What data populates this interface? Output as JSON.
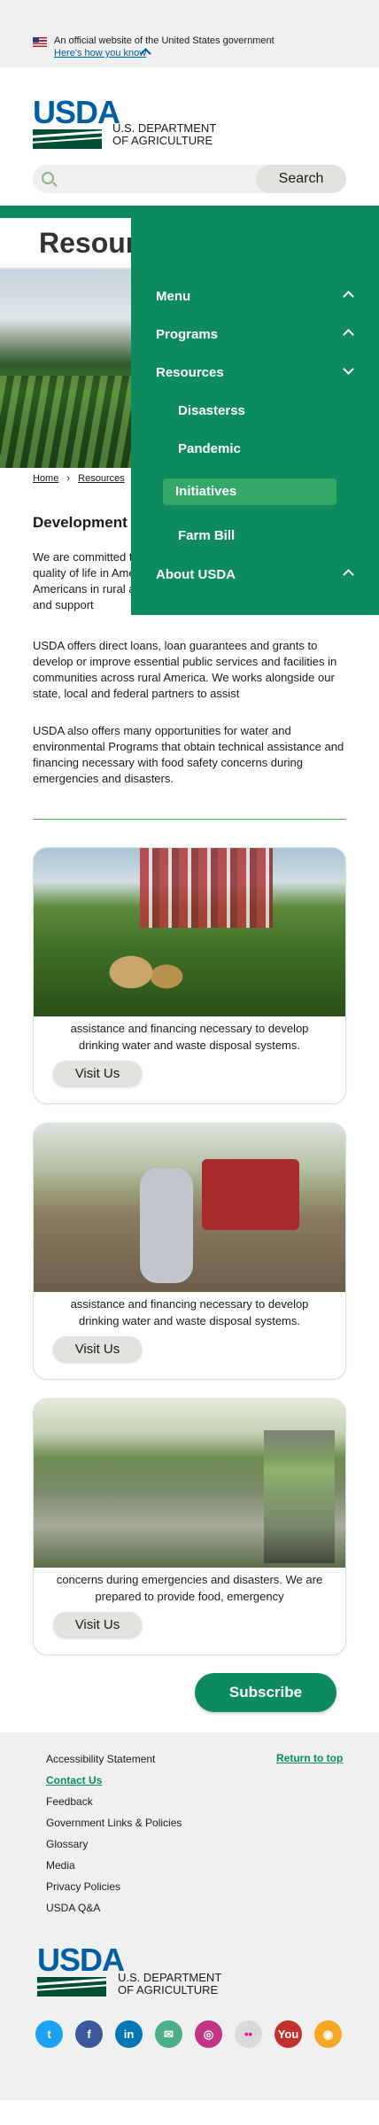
{
  "gov_banner": {
    "text": "An official website of the United States government",
    "link": "Here's how you know"
  },
  "header": {
    "logo_text": "USDA",
    "dept_line1": "U.S. DEPARTMENT",
    "dept_line2": "OF AGRICULTURE",
    "search_placeholder": "",
    "search_button": "Search"
  },
  "page": {
    "title": "Resources"
  },
  "breadcrumb": {
    "home": "Home",
    "resources": "Resources"
  },
  "content": {
    "section_title": "Development",
    "p1": "We are committed to helping improve the economy and quality of life in America. We offer programs that help Americans in rural areas and loan guarantees for community and support",
    "p2": "USDA offers direct loans, loan guarantees and grants to develop or improve essential public services and facilities in communities across rural America. We works alongside our state, local and federal partners to assist",
    "p3": "USDA also offers many opportunities for water and environmental Programs that obtain technical assistance and financing necessary with food safety concerns during emergencies and disasters."
  },
  "cards": [
    {
      "text": "assistance and financing necessary to develop drinking water and waste disposal systems.",
      "button": "Visit Us"
    },
    {
      "text": "assistance and financing necessary to develop drinking water and waste disposal systems.",
      "button": "Visit Us"
    },
    {
      "text": "concerns during emergencies and disasters. We are prepared to provide food, emergency",
      "button": "Visit Us"
    }
  ],
  "subscribe": "Subscribe",
  "footer": {
    "links": [
      "Accessibility Statement",
      "Contact Us",
      "Feedback",
      "Government Links & Policies",
      "Glossary",
      "Media",
      "Privacy Policies",
      "USDA Q&A"
    ],
    "return_top": "Return to top"
  },
  "social": [
    {
      "name": "twitter-icon",
      "glyph": "t",
      "color": "#1da1f2"
    },
    {
      "name": "facebook-icon",
      "glyph": "f",
      "color": "#3b5998"
    },
    {
      "name": "linkedin-icon",
      "glyph": "in",
      "color": "#0077b5"
    },
    {
      "name": "email-icon",
      "glyph": "✉",
      "color": "#4caf87"
    },
    {
      "name": "instagram-icon",
      "glyph": "◎",
      "color": "#c13584"
    },
    {
      "name": "flickr-icon",
      "glyph": "••",
      "color": "#d9d9d9"
    },
    {
      "name": "youtube-icon",
      "glyph": "You",
      "color": "#c4302b"
    },
    {
      "name": "rss-icon",
      "glyph": "◉",
      "color": "#f5a623"
    }
  ],
  "menu": {
    "items": [
      "Menu",
      "Programs",
      "Resources"
    ],
    "subitems": [
      "Disasterss",
      "Pandemic",
      "Initiatives",
      "Farm Bill"
    ],
    "last": "About USDA"
  }
}
